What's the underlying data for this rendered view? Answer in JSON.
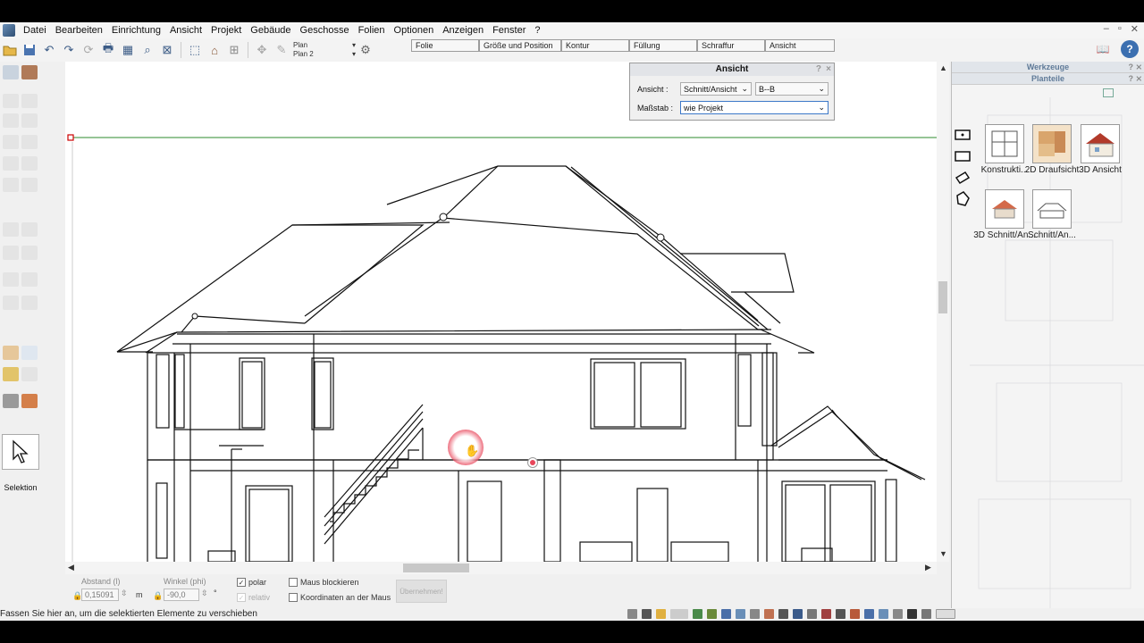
{
  "menu": {
    "items": [
      "Datei",
      "Bearbeiten",
      "Einrichtung",
      "Ansicht",
      "Projekt",
      "Gebäude",
      "Geschosse",
      "Folien",
      "Optionen",
      "Anzeigen",
      "Fenster",
      "?"
    ]
  },
  "toolbar": {
    "plan_1": "Plan",
    "plan_2": "Plan 2",
    "property_tabs": [
      "Folie",
      "Größe und Position",
      "Kontur",
      "Füllung",
      "Schraffur",
      "Ansicht"
    ]
  },
  "dialog": {
    "title": "Ansicht",
    "help": "?",
    "close": "×",
    "ansicht_label": "Ansicht :",
    "ansicht_value": "Schnitt/Ansicht",
    "section_value": "B--B",
    "massstab_label": "Maßstab :",
    "massstab_value": "wie Projekt"
  },
  "left_tools": {
    "selection_label": "Selektion"
  },
  "status": {
    "abstand_label": "Abstand (l)",
    "abstand_value": "0,15091",
    "abstand_unit": "m",
    "winkel_label": "Winkel (phi)",
    "winkel_value": "-90,0",
    "winkel_unit": "°",
    "polar_label": "polar",
    "polar_checked": true,
    "relativ_label": "relativ",
    "maus_blockieren_label": "Maus blockieren",
    "koordinaten_label": "Koordinaten an der Maus",
    "apply_label": "Übernehmen!",
    "hint": "Fassen Sie hier an, um die selektierten Elemente zu verschieben"
  },
  "right_panel": {
    "werkzeuge_title": "Werkzeuge",
    "planteile_title": "Planteile",
    "tiles": [
      {
        "label": "Konstrukti..."
      },
      {
        "label": "2D Draufsicht"
      },
      {
        "label": "3D Ansicht"
      },
      {
        "label": "3D Schnitt/An..."
      },
      {
        "label": "Schnitt/An..."
      }
    ]
  },
  "colors": {
    "accent": "#5f7a98",
    "guide_line": "#2e8b2e",
    "cursor_highlight": "#e8475b"
  }
}
